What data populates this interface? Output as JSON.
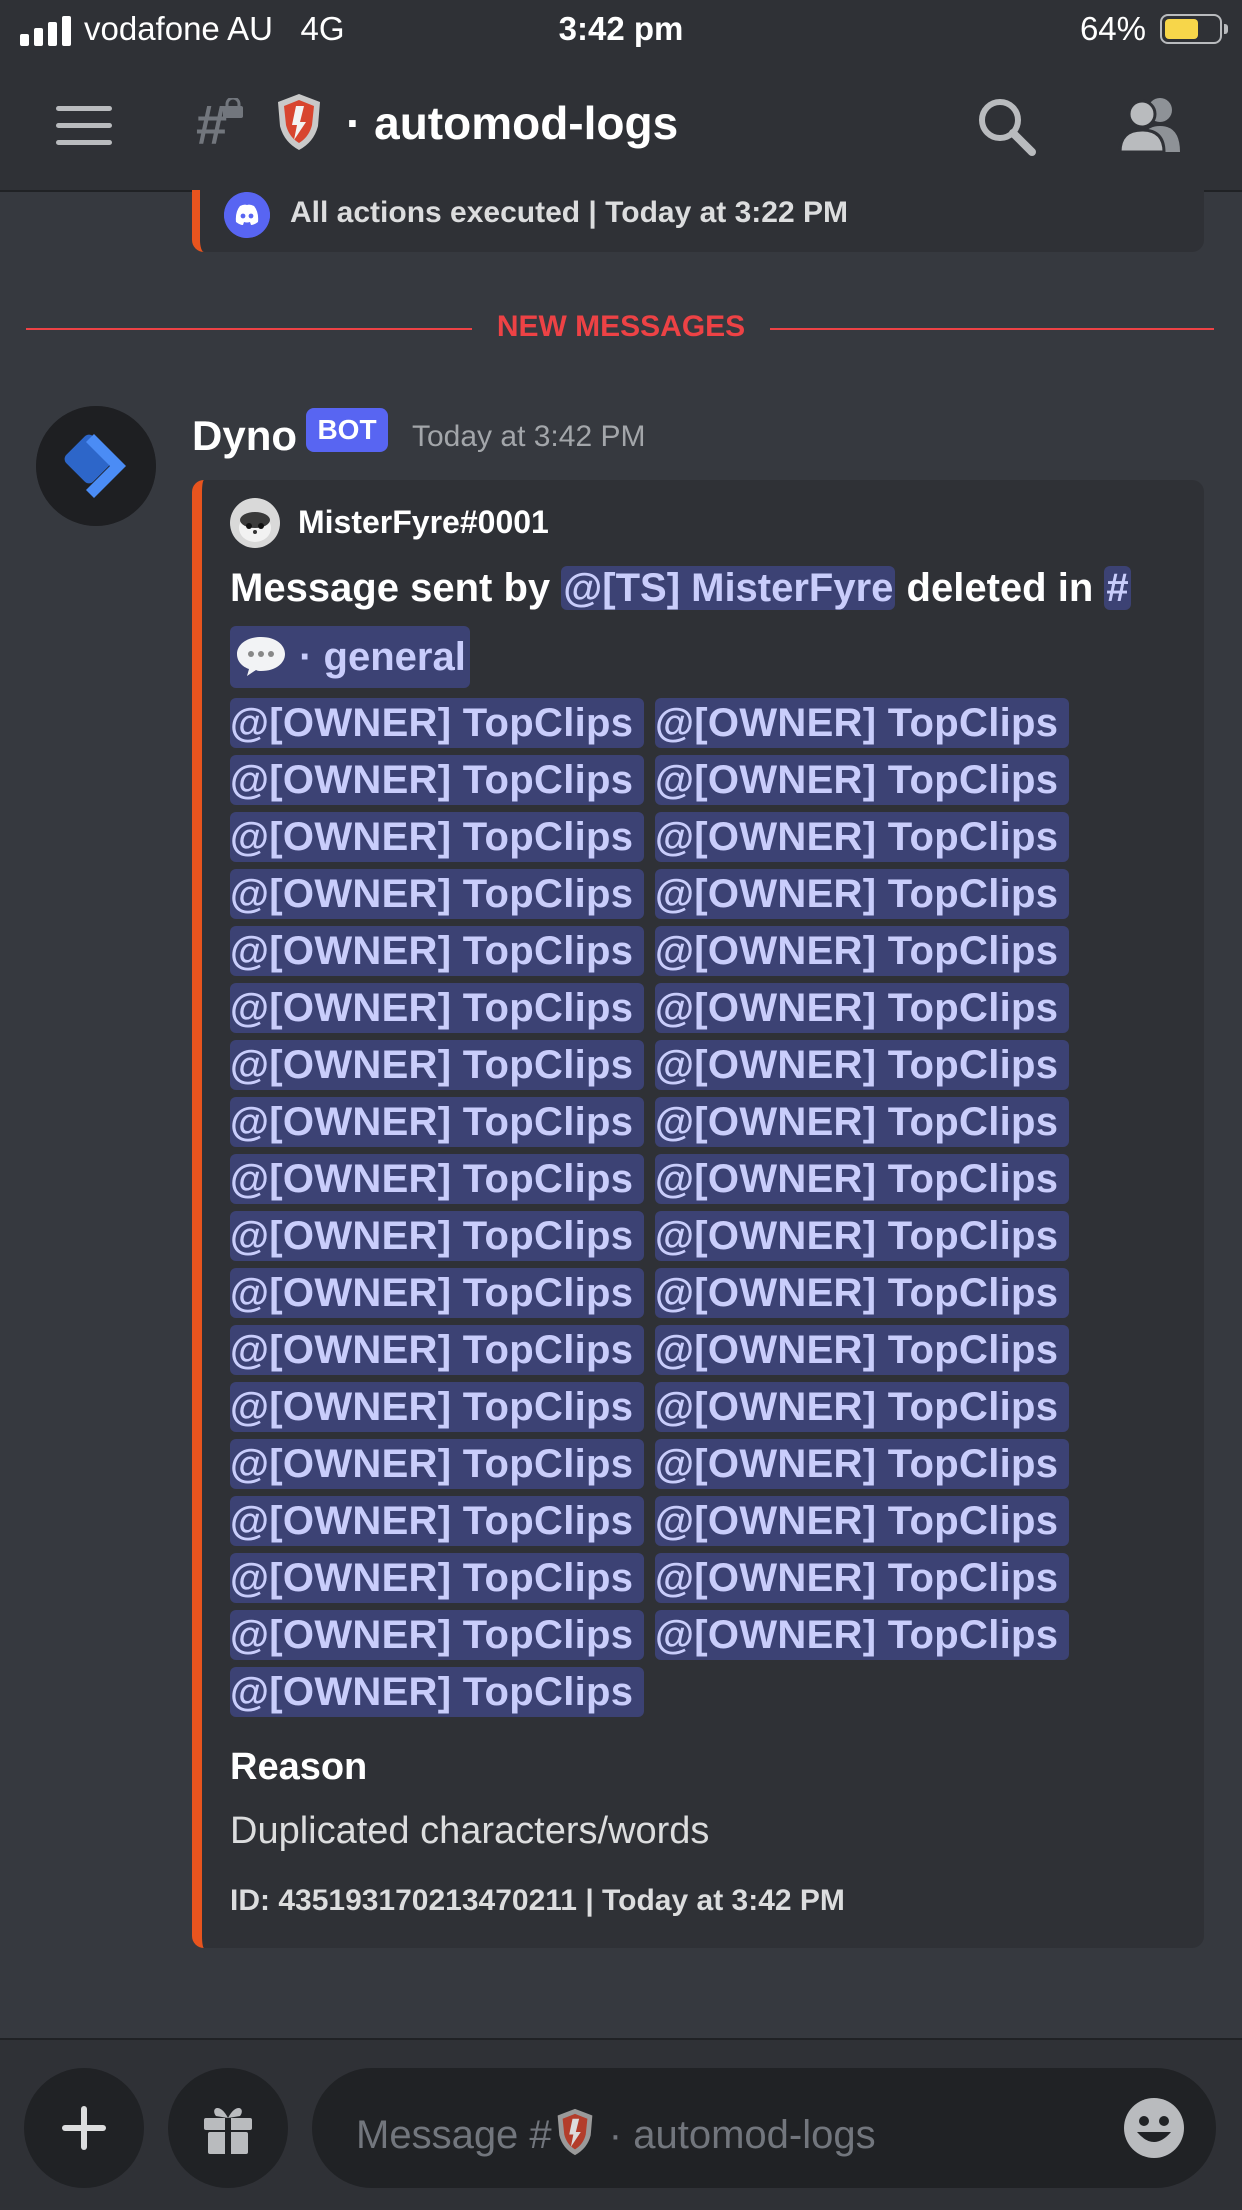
{
  "status_bar": {
    "carrier": "vodafone AU",
    "network": "4G",
    "time": "3:42 pm",
    "battery_percent": "64%",
    "battery_level": 0.64
  },
  "header": {
    "channel_name": "automod-logs",
    "separator": "·"
  },
  "previous_embed": {
    "footer": "All actions executed | Today at 3:22 PM"
  },
  "divider": {
    "label": "NEW MESSAGES"
  },
  "message": {
    "author": "Dyno",
    "bot_tag": "BOT",
    "timestamp": "Today at 3:42 PM",
    "embed": {
      "author_name": "MisterFyre#0001",
      "description_prefix": "Message sent by ",
      "mention_user": "@[TS] MisterFyre",
      "description_middle": " deleted in ",
      "channel_hash": "#",
      "channel_separator": " · ",
      "channel_name": "general",
      "mention_text": "@[OWNER] TopClips",
      "mention_rows": [
        [
          "@[OWNER] TopClips",
          "@[OWNER] TopClips"
        ],
        [
          "@[OWNER] TopClips",
          "@[OWNER] TopClips"
        ],
        [
          "@[OWNER] TopClips",
          "@[OWNER] TopClips"
        ],
        [
          "@[OWNER] TopClips",
          "@[OWNER] TopClips"
        ],
        [
          "@[OWNER] TopClips",
          "@[OWNER] TopClips"
        ],
        [
          "@[OWNER] TopClips",
          "@[OWNER] TopClips"
        ],
        [
          "@[OWNER] TopClips",
          "@[OWNER] TopClips"
        ],
        [
          "@[OWNER] TopClips",
          "@[OWNER] TopClips"
        ],
        [
          "@[OWNER] TopClips",
          "@[OWNER] TopClips"
        ],
        [
          "@[OWNER] TopClips",
          "@[OWNER] TopClips"
        ],
        [
          "@[OWNER] TopClips",
          "@[OWNER] TopClips"
        ],
        [
          "@[OWNER] TopClips",
          "@[OWNER] TopClips"
        ],
        [
          "@[OWNER] TopClips",
          "@[OWNER] TopClips"
        ],
        [
          "@[OWNER] TopClips",
          "@[OWNER] TopClips"
        ],
        [
          "@[OWNER] TopClips",
          "@[OWNER] TopClips"
        ],
        [
          "@[OWNER] TopClips",
          "@[OWNER] TopClips"
        ],
        [
          "@[OWNER] TopClips",
          "@[OWNER] TopClips"
        ],
        [
          "@[OWNER] TopClips"
        ]
      ],
      "field_name": "Reason",
      "field_value": "Duplicated characters/words",
      "footer": "ID: 435193170213470211 | Today at 3:42 PM"
    }
  },
  "composer": {
    "placeholder_prefix": "Message #",
    "placeholder_separator": " · ",
    "placeholder_channel": "automod-logs"
  },
  "colors": {
    "background": "#36393f",
    "embed_accent": "#e8541e",
    "mention_bg": "#3c4274",
    "mention_text": "#c9cdfb",
    "bot_tag": "#5865f2",
    "new_messages": "#ed4245"
  },
  "icons": [
    "signal-icon",
    "battery-icon",
    "menu-icon",
    "locked-hash-icon",
    "shield-icon",
    "search-icon",
    "members-icon",
    "discord-icon",
    "dyno-avatar-icon",
    "speech-bubble-icon",
    "plus-icon",
    "gift-icon",
    "emoji-icon"
  ]
}
